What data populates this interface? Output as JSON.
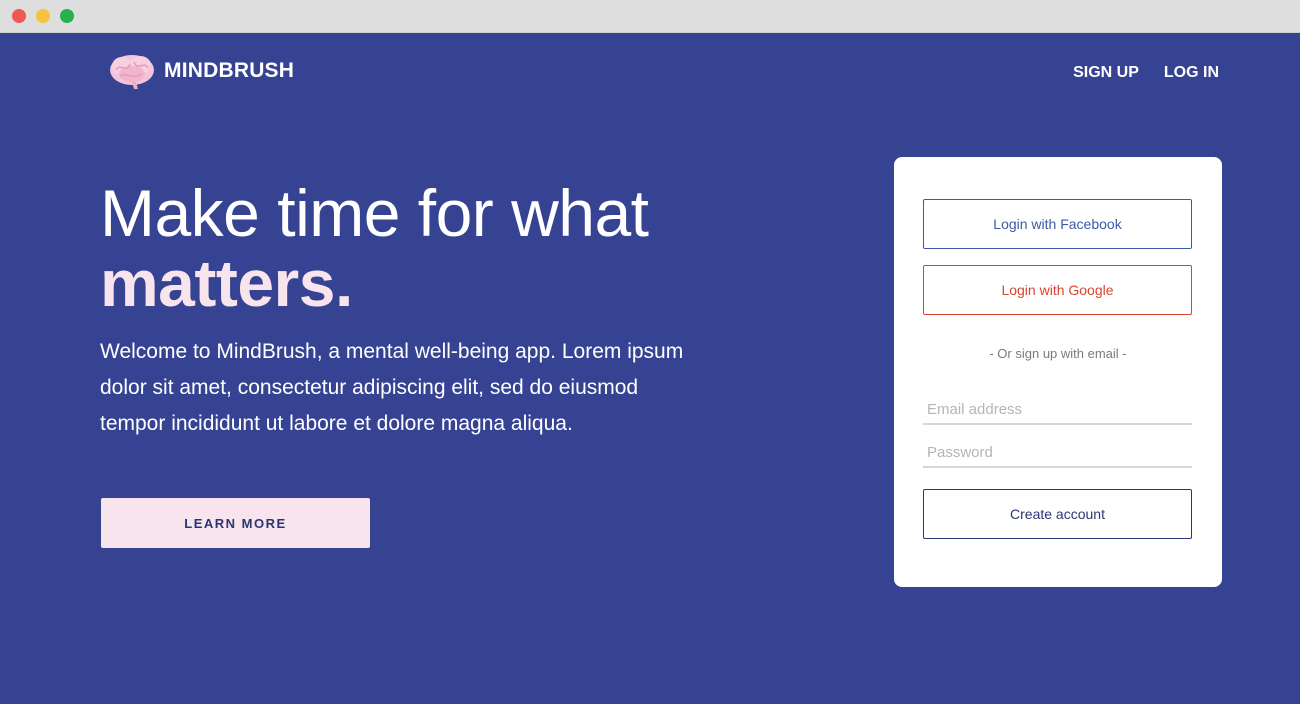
{
  "window": {
    "controls": [
      "close",
      "minimize",
      "maximize"
    ]
  },
  "brand": {
    "name": "MINDBRUSH",
    "logo_icon": "brain-icon"
  },
  "nav": {
    "signup": "SIGN UP",
    "login": "LOG IN"
  },
  "hero": {
    "headline_line1": "Make time for what",
    "headline_line2": "matters.",
    "intro": "Welcome to MindBrush, a mental well-being app. Lorem ipsum dolor sit amet, consectetur adipiscing elit, sed do eiusmod tempor incididunt ut labore et dolore magna aliqua.",
    "cta": "LEARN MORE"
  },
  "auth_card": {
    "facebook": "Login with Facebook",
    "google": "Login with Google",
    "divider": "- Or sign up with email -",
    "email_placeholder": "Email address",
    "email_value": "",
    "password_placeholder": "Password",
    "password_value": "",
    "create": "Create account"
  },
  "colors": {
    "background": "#364393",
    "accent_pink": "#f7e4ec",
    "facebook": "#3b5aa8",
    "google": "#d9452e",
    "navy": "#2b3576"
  }
}
